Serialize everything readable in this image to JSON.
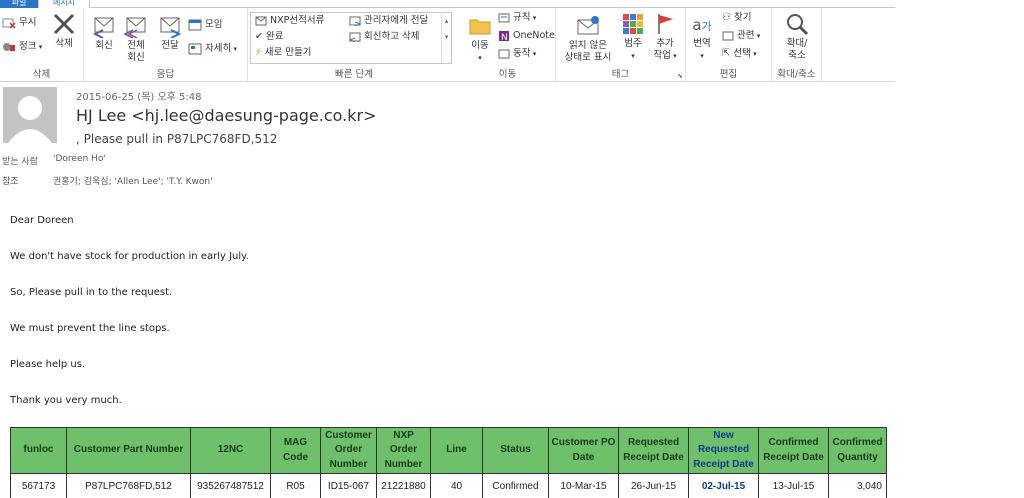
{
  "tabs": {
    "file": "파일",
    "message": "메시지"
  },
  "ribbon": {
    "delete_group": {
      "label": "삭제",
      "ignore": "무시",
      "cleanup": "정크",
      "delete": "삭제"
    },
    "respond_group": {
      "label": "응답",
      "reply": "회신",
      "reply_all_1": "전체",
      "reply_all_2": "회신",
      "forward": "전달",
      "meeting": "모임",
      "more": "자세히"
    },
    "quick_steps": {
      "label": "빠른 단계",
      "items": [
        "NXP선적서류",
        "관리자에게 전달",
        "완료",
        "회신하고 삭제",
        "새로 만들기"
      ]
    },
    "move_group": {
      "label": "이동",
      "move": "이동",
      "rules": "규칙",
      "onenote": "OneNote",
      "actions": "동작"
    },
    "tags_group": {
      "label": "태그",
      "unread_1": "읽지 않은",
      "unread_2": "상태로 표시",
      "categorize": "범주",
      "followup_1": "추가",
      "followup_2": "작업"
    },
    "edit_group": {
      "label": "편집",
      "translate": "번역",
      "find": "찾기",
      "related": "관련",
      "select": "선택"
    },
    "zoom_group": {
      "label": "확대/축소",
      "zoom_1": "확대/",
      "zoom_2": "축소"
    }
  },
  "email": {
    "date": "2015-06-25 (목) 오후 5:48",
    "from": "HJ Lee <hj.lee@daesung-page.co.kr>",
    "subject": ", Please pull in P87LPC768FD,512",
    "to_label": "받는 사람",
    "to_value": "'Doreen Ho'",
    "cc_label": "참조",
    "cc_value": "권홍기; 김옥심; 'Allen Lee'; 'T.Y. Kwon'",
    "body": [
      "Dear Doreen",
      "We don't have stock for production in early July.",
      "So, Please pull in to the request.",
      "We must prevent the line stops.",
      "Please help us.",
      "Thank you very much."
    ]
  },
  "table": {
    "headers": [
      "funloc",
      "Customer Part Number",
      "12NC",
      "MAG Code",
      "Customer Order Number",
      "NXP Order Number",
      "Line",
      "Status",
      "Customer PO Date",
      "Requested Receipt Date",
      "New Requested Receipt Date",
      "Confirmed Receipt Date",
      "Confirmed Quantity"
    ],
    "rows": [
      [
        "567173",
        "P87LPC768FD,512",
        "935267487512",
        "R05",
        "ID15-067",
        "21221880",
        "40",
        "Confirmed",
        "10-Mar-15",
        "26-Jun-15",
        "02-Jul-15",
        "13-Jul-15",
        "3,040"
      ]
    ]
  }
}
